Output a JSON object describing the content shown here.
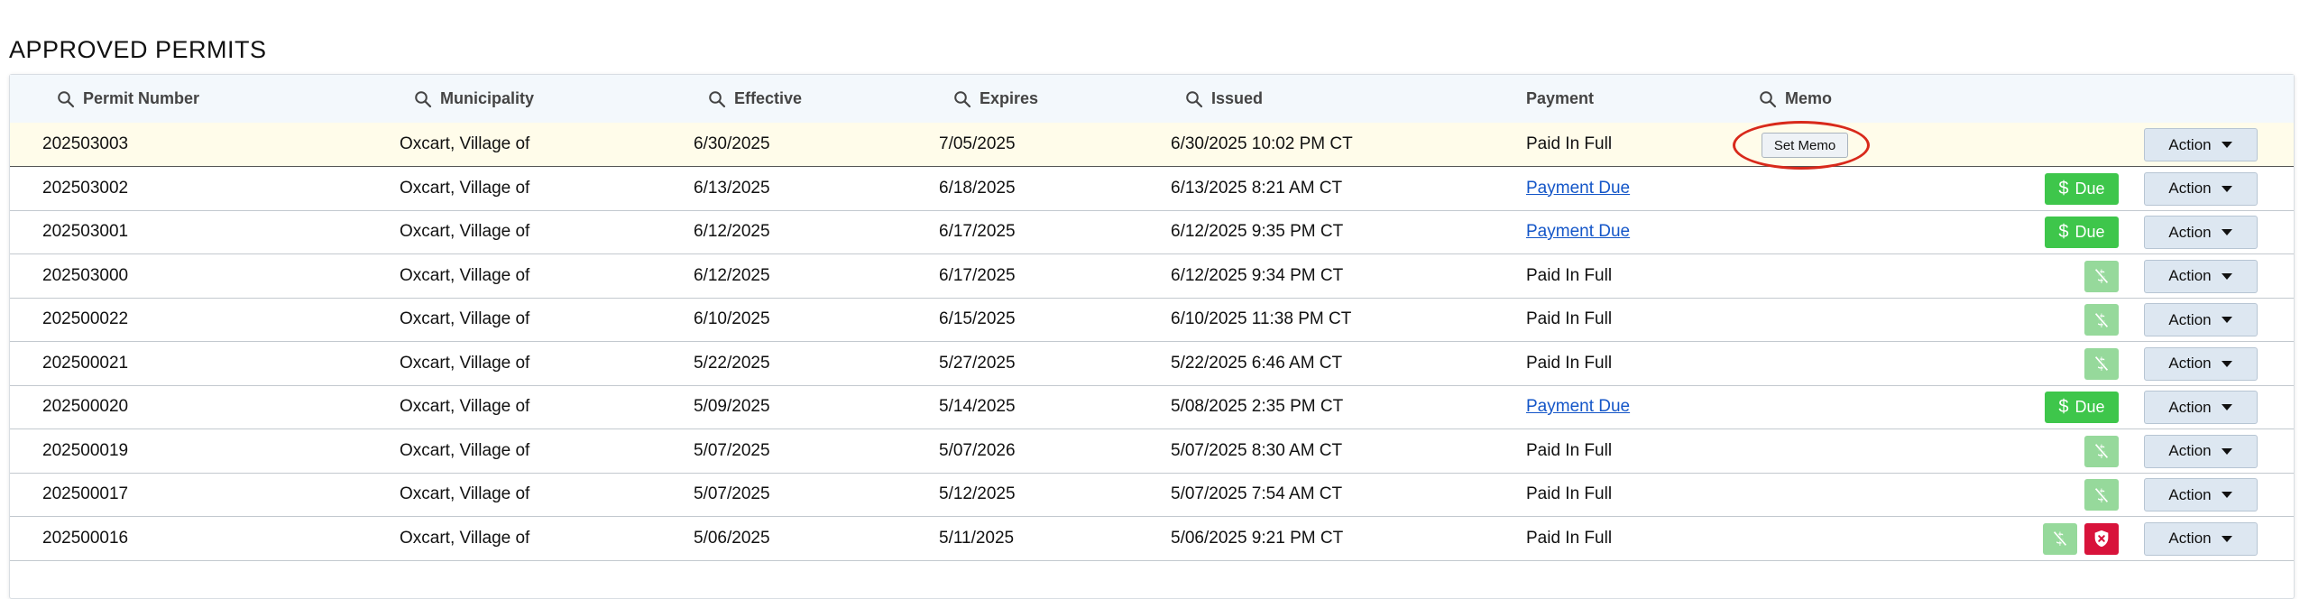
{
  "page": {
    "title": "APPROVED PERMITS"
  },
  "table": {
    "columns": [
      {
        "label": "Permit Number",
        "searchable": true
      },
      {
        "label": "Municipality",
        "searchable": true
      },
      {
        "label": "Effective",
        "searchable": true
      },
      {
        "label": "Expires",
        "searchable": true
      },
      {
        "label": "Issued",
        "searchable": true
      },
      {
        "label": "Payment",
        "searchable": false
      },
      {
        "label": "Memo",
        "searchable": true
      }
    ],
    "action_label": "Action",
    "due_label": "Due",
    "set_memo_label": "Set Memo",
    "rows": [
      {
        "permit": "202503003",
        "municipality": "Oxcart, Village of",
        "effective": "6/30/2025",
        "expires": "7/05/2025",
        "issued": "6/30/2025 10:02 PM CT",
        "payment": "Paid In Full",
        "payment_due": false,
        "memo_button": true,
        "status_icons": []
      },
      {
        "permit": "202503002",
        "municipality": "Oxcart, Village of",
        "effective": "6/13/2025",
        "expires": "6/18/2025",
        "issued": "6/13/2025 8:21 AM CT",
        "payment": "Payment Due",
        "payment_due": true,
        "memo_button": false,
        "status_icons": [
          "due"
        ]
      },
      {
        "permit": "202503001",
        "municipality": "Oxcart, Village of",
        "effective": "6/12/2025",
        "expires": "6/17/2025",
        "issued": "6/12/2025 9:35 PM CT",
        "payment": "Payment Due",
        "payment_due": true,
        "memo_button": false,
        "status_icons": [
          "due"
        ]
      },
      {
        "permit": "202503000",
        "municipality": "Oxcart, Village of",
        "effective": "6/12/2025",
        "expires": "6/17/2025",
        "issued": "6/12/2025 9:34 PM CT",
        "payment": "Paid In Full",
        "payment_due": false,
        "memo_button": false,
        "status_icons": [
          "paid"
        ]
      },
      {
        "permit": "202500022",
        "municipality": "Oxcart, Village of",
        "effective": "6/10/2025",
        "expires": "6/15/2025",
        "issued": "6/10/2025 11:38 PM CT",
        "payment": "Paid In Full",
        "payment_due": false,
        "memo_button": false,
        "status_icons": [
          "paid"
        ]
      },
      {
        "permit": "202500021",
        "municipality": "Oxcart, Village of",
        "effective": "5/22/2025",
        "expires": "5/27/2025",
        "issued": "5/22/2025 6:46 AM CT",
        "payment": "Paid In Full",
        "payment_due": false,
        "memo_button": false,
        "status_icons": [
          "paid"
        ]
      },
      {
        "permit": "202500020",
        "municipality": "Oxcart, Village of",
        "effective": "5/09/2025",
        "expires": "5/14/2025",
        "issued": "5/08/2025 2:35 PM CT",
        "payment": "Payment Due",
        "payment_due": true,
        "memo_button": false,
        "status_icons": [
          "due"
        ]
      },
      {
        "permit": "202500019",
        "municipality": "Oxcart, Village of",
        "effective": "5/07/2025",
        "expires": "5/07/2026",
        "issued": "5/07/2025 8:30 AM CT",
        "payment": "Paid In Full",
        "payment_due": false,
        "memo_button": false,
        "status_icons": [
          "paid"
        ]
      },
      {
        "permit": "202500017",
        "municipality": "Oxcart, Village of",
        "effective": "5/07/2025",
        "expires": "5/12/2025",
        "issued": "5/07/2025 7:54 AM CT",
        "payment": "Paid In Full",
        "payment_due": false,
        "memo_button": false,
        "status_icons": [
          "paid"
        ]
      },
      {
        "permit": "202500016",
        "municipality": "Oxcart, Village of",
        "effective": "5/06/2025",
        "expires": "5/11/2025",
        "issued": "5/06/2025 9:21 PM CT",
        "payment": "Paid In Full",
        "payment_due": false,
        "memo_button": false,
        "status_icons": [
          "paid",
          "shield"
        ]
      }
    ]
  },
  "colors": {
    "due_green": "#3ec64b",
    "paid_green": "#96d99b",
    "shield_red": "#d8133b",
    "link_blue": "#1456c8",
    "highlight_row": "#fffcea",
    "annotation_red": "#d8291b"
  }
}
